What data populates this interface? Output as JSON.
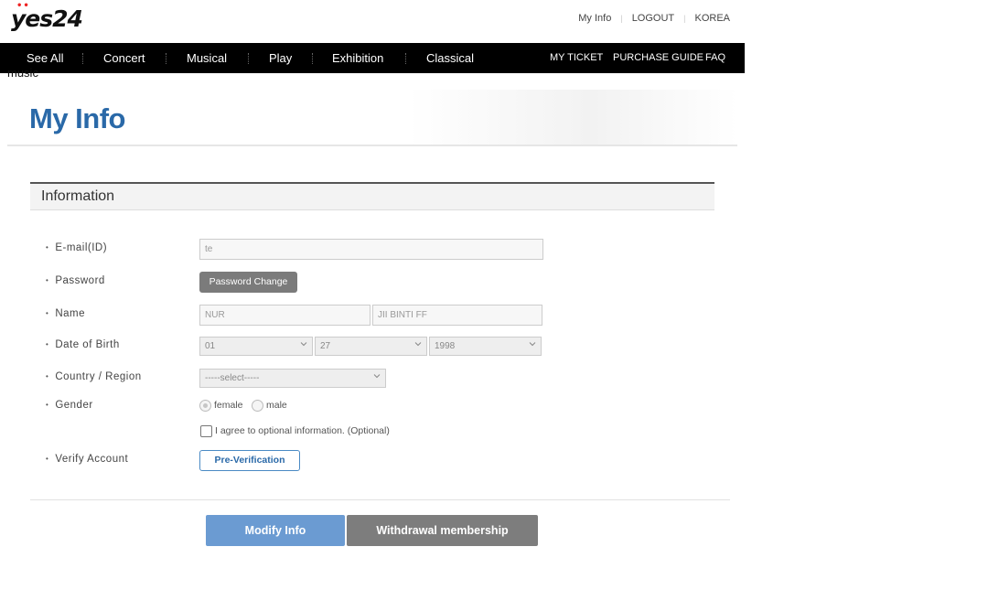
{
  "header": {
    "logo_text": "yes24",
    "util_links": [
      "My Info",
      "LOGOUT",
      "KOREA"
    ]
  },
  "nav": {
    "items": [
      "See All",
      "Concert",
      "Musical",
      "Play",
      "Exhibition",
      "Classical"
    ],
    "overflow_text": "music",
    "right_items": [
      "MY TICKET",
      "PURCHASE GUIDE",
      "FAQ"
    ]
  },
  "page": {
    "title": "My Info",
    "section_title": "Information"
  },
  "form": {
    "email": {
      "label": "E-mail(ID)",
      "value": "te"
    },
    "password": {
      "label": "Password",
      "button": "Password Change"
    },
    "name": {
      "label": "Name",
      "first": "NUR",
      "last": "JII BINTI FF"
    },
    "birth": {
      "label": "Date of Birth",
      "month": "01",
      "day": "27",
      "year": "1998"
    },
    "country": {
      "label": "Country / Region",
      "placeholder": "-----select-----"
    },
    "gender": {
      "label": "Gender",
      "female": "female",
      "male": "male",
      "selected": "female"
    },
    "optional": {
      "label": "I agree to optional information. (Optional)",
      "checked": false
    },
    "verify": {
      "label": "Verify Account",
      "button": "Pre-Verification"
    }
  },
  "actions": {
    "modify": "Modify Info",
    "withdraw": "Withdrawal membership"
  },
  "colors": {
    "title_blue": "#2a69a8",
    "primary_button": "#6b9bd2",
    "secondary_button": "#7d7d7d",
    "nav_bg": "#000000"
  }
}
